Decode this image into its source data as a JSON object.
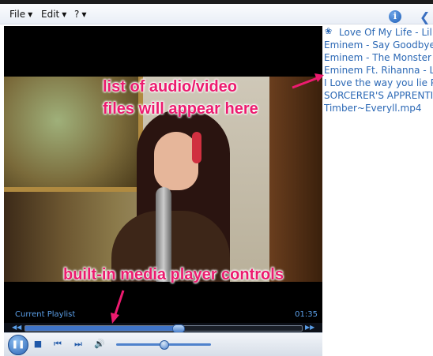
{
  "menubar": {
    "items": [
      {
        "label": "File"
      },
      {
        "label": "Edit"
      },
      {
        "label": "?"
      }
    ]
  },
  "icons": {
    "info": "info-icon",
    "back": "back-arrow-icon"
  },
  "playlist": {
    "items": [
      "Love Of My Life - Lil S",
      "Eminem - Say Goodbye",
      "Eminem - The Monster (",
      "Eminem Ft. Rihanna - Lo",
      "I Love the way you lie Pa",
      "SORCERER'S APPRENTIC",
      "Timber~Everyll.mp4"
    ]
  },
  "annotations": {
    "list_line1": "list of audio/video",
    "list_line2": "files will appear here",
    "controls": "built-in media player controls"
  },
  "player": {
    "playlist_label": "Current Playlist",
    "time": "01:35",
    "seek_progress": 0.55,
    "volume_level": 0.5
  },
  "colors": {
    "annotation": "#ec1b6f",
    "link": "#2b68b5",
    "accent": "#5b9fe8"
  }
}
